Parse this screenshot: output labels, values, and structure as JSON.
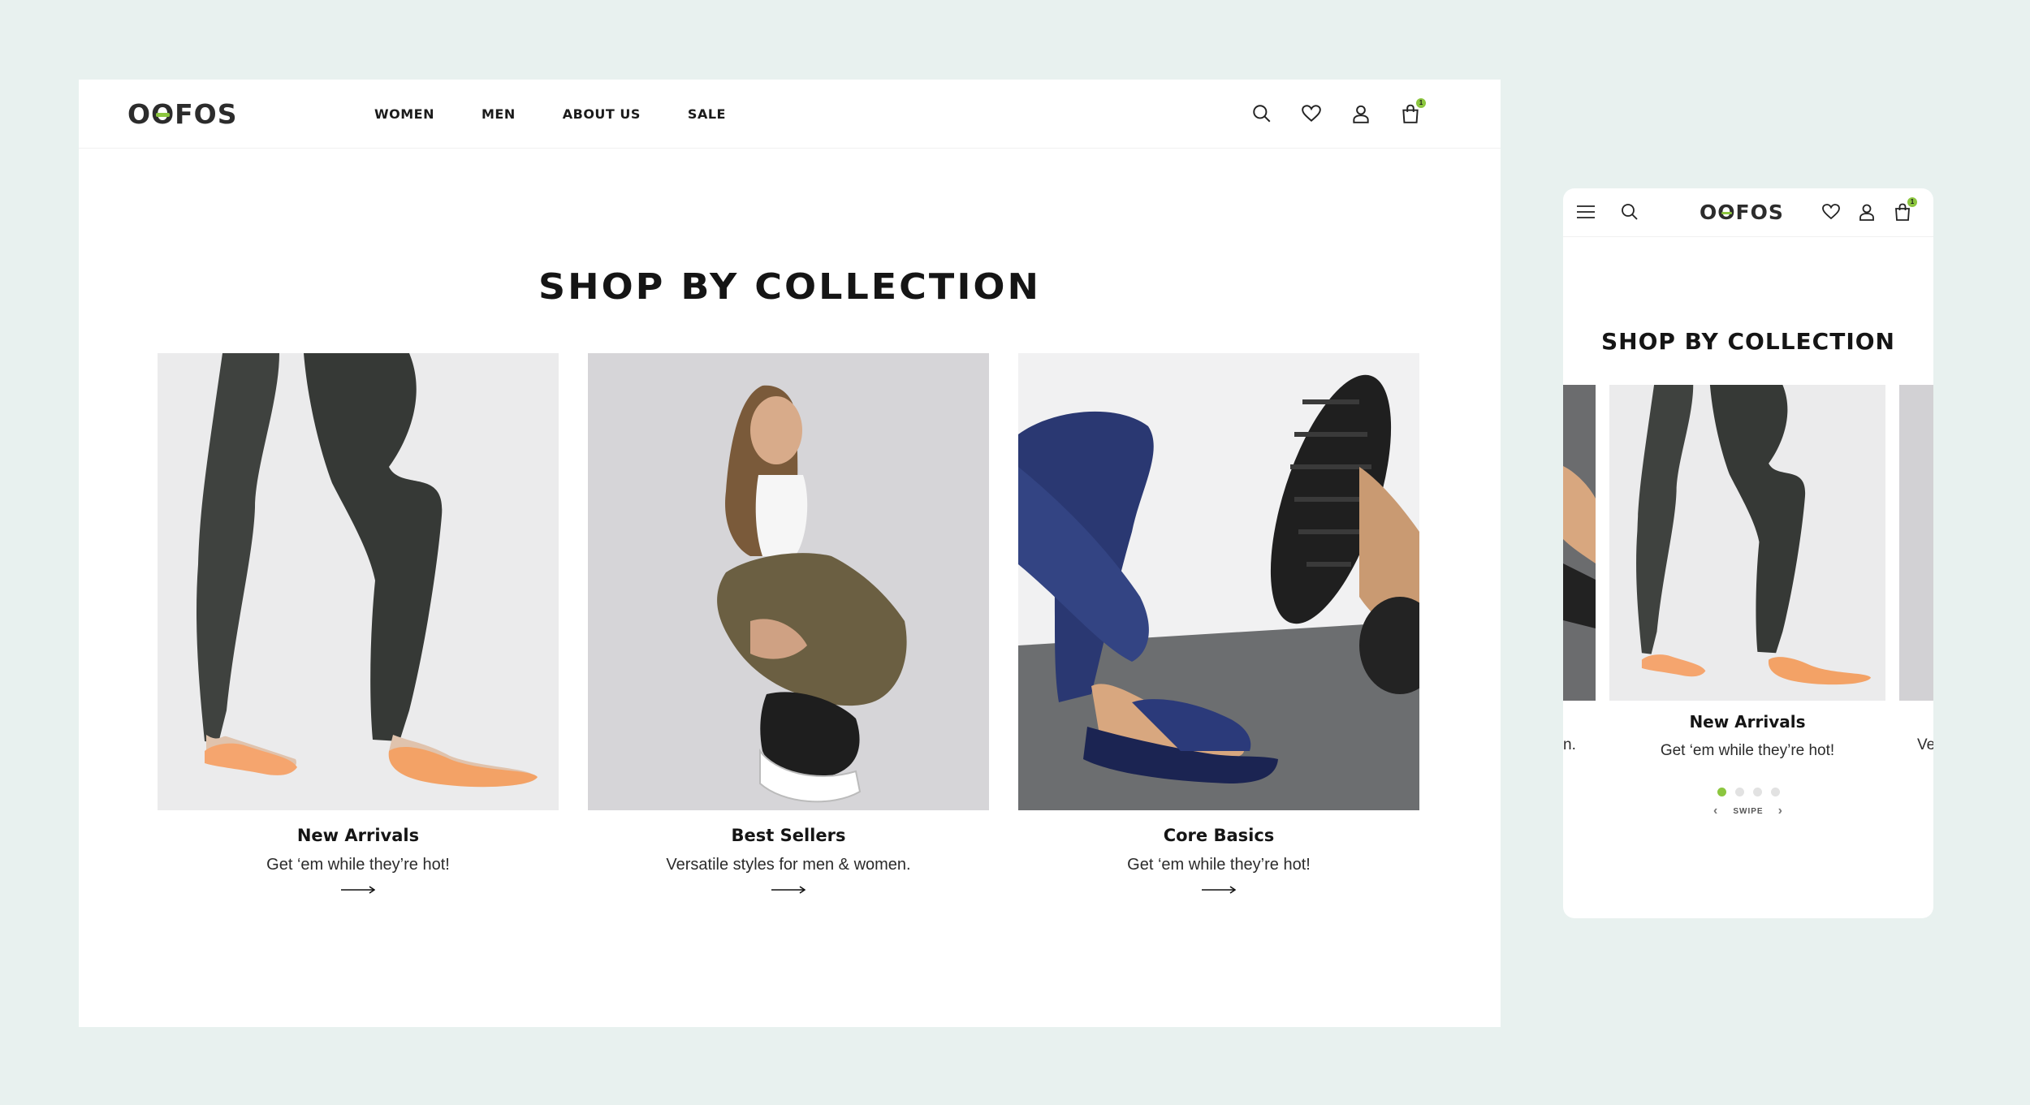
{
  "brand": {
    "logo": "OOFOS",
    "accent_color": "#8cc63f",
    "background_color": "#e8f1ef"
  },
  "desktop": {
    "nav": [
      {
        "label": "WOMEN"
      },
      {
        "label": "MEN"
      },
      {
        "label": "ABOUT US"
      },
      {
        "label": "SALE"
      }
    ],
    "icons": [
      "search-icon",
      "heart-icon",
      "user-icon",
      "bag-icon"
    ],
    "cart_count": "1",
    "section_title": "SHOP BY COLLECTION",
    "cards": [
      {
        "title": "New Arrivals",
        "subtitle": "Get ‘em while they’re hot!",
        "image": "legs-orange-flip-flops"
      },
      {
        "title": "Best Sellers",
        "subtitle": "Versatile styles for men & women.",
        "image": "woman-crouching-black-sneaker"
      },
      {
        "title": "Core Basics",
        "subtitle": "Get ‘em while they’re hot!",
        "image": "navy-slide-sandals"
      }
    ]
  },
  "mobile": {
    "icons": [
      "menu-icon",
      "search-icon",
      "heart-icon",
      "user-icon",
      "bag-icon"
    ],
    "cart_count": "1",
    "section_title": "SHOP BY COLLECTION",
    "card": {
      "title": "New Arrivals",
      "subtitle": "Get ‘em while they’re hot!"
    },
    "peek_left_text": "n.",
    "peek_right_text": "Ve",
    "dots_total": 4,
    "dots_active": 1,
    "swipe_label": "SWIPE"
  }
}
